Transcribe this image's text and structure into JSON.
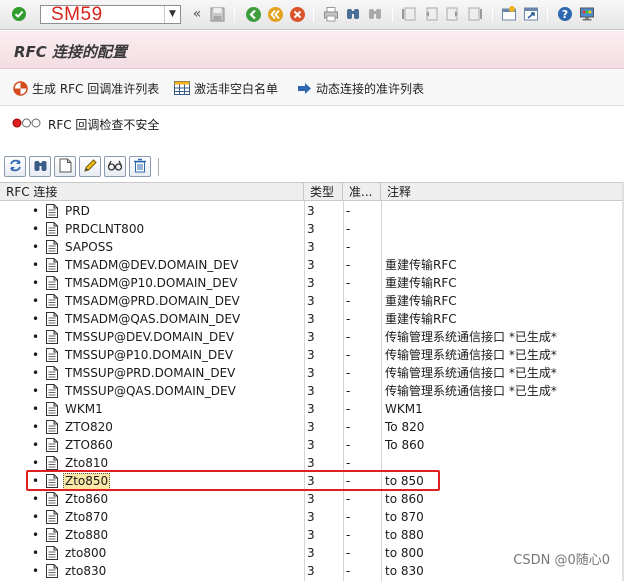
{
  "command_field": {
    "value": "SM59"
  },
  "title": "RFC 连接的配置",
  "app_toolbar": {
    "generate_label": "生成 RFC 回调准许列表",
    "activate_label": "激活非空白名单",
    "dynamic_label": "动态连接的准许列表"
  },
  "security_status": "RFC 回调检查不安全",
  "table": {
    "headers": {
      "name": "RFC 连接",
      "type": "类型",
      "permit": "准...",
      "note": "注释"
    },
    "rows": [
      {
        "name": "PRD",
        "type": "3",
        "permit": "-",
        "note": ""
      },
      {
        "name": "PRDCLNT800",
        "type": "3",
        "permit": "-",
        "note": ""
      },
      {
        "name": "SAPOSS",
        "type": "3",
        "permit": "-",
        "note": ""
      },
      {
        "name": "TMSADM@DEV.DOMAIN_DEV",
        "type": "3",
        "permit": "-",
        "note": "重建传输RFC"
      },
      {
        "name": "TMSADM@P10.DOMAIN_DEV",
        "type": "3",
        "permit": "-",
        "note": "重建传输RFC"
      },
      {
        "name": "TMSADM@PRD.DOMAIN_DEV",
        "type": "3",
        "permit": "-",
        "note": "重建传输RFC"
      },
      {
        "name": "TMSADM@QAS.DOMAIN_DEV",
        "type": "3",
        "permit": "-",
        "note": "重建传输RFC"
      },
      {
        "name": "TMSSUP@DEV.DOMAIN_DEV",
        "type": "3",
        "permit": "-",
        "note": "传输管理系统通信接口  *已生成*"
      },
      {
        "name": "TMSSUP@P10.DOMAIN_DEV",
        "type": "3",
        "permit": "-",
        "note": "传输管理系统通信接口  *已生成*"
      },
      {
        "name": "TMSSUP@PRD.DOMAIN_DEV",
        "type": "3",
        "permit": "-",
        "note": "传输管理系统通信接口  *已生成*"
      },
      {
        "name": "TMSSUP@QAS.DOMAIN_DEV",
        "type": "3",
        "permit": "-",
        "note": "传输管理系统通信接口  *已生成*"
      },
      {
        "name": "WKM1",
        "type": "3",
        "permit": "-",
        "note": "WKM1"
      },
      {
        "name": "ZTO820",
        "type": "3",
        "permit": "-",
        "note": "To 820"
      },
      {
        "name": "ZTO860",
        "type": "3",
        "permit": "-",
        "note": "To 860"
      },
      {
        "name": "Zto810",
        "type": "3",
        "permit": "-",
        "note": ""
      },
      {
        "name": "Zto850",
        "type": "3",
        "permit": "-",
        "note": "to 850"
      },
      {
        "name": "Zto860",
        "type": "3",
        "permit": "-",
        "note": "to  860"
      },
      {
        "name": "Zto870",
        "type": "3",
        "permit": "-",
        "note": "to 870"
      },
      {
        "name": "Zto880",
        "type": "3",
        "permit": "-",
        "note": "to  880"
      },
      {
        "name": "zto800",
        "type": "3",
        "permit": "-",
        "note": "to 800"
      },
      {
        "name": "zto830",
        "type": "3",
        "permit": "-",
        "note": "to 830"
      }
    ]
  },
  "watermark": "CSDN @0随心0",
  "colors": {
    "title_bg": "#f3dde2",
    "highlight_border": "#e02020",
    "command_text": "#d8231b",
    "selected_cell": "#f9e7a7"
  }
}
